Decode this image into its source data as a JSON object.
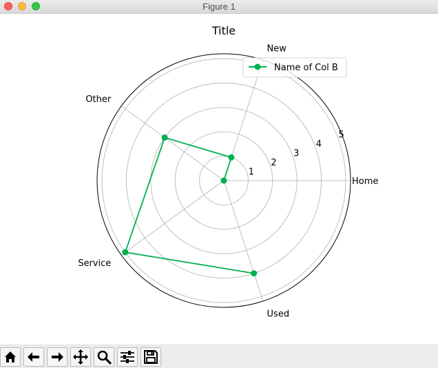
{
  "window": {
    "title": "Figure 1",
    "controls": {
      "close_color": "#fc605c",
      "minimize_color": "#fdbc40",
      "maximize_color": "#34c84a"
    }
  },
  "toolbar": {
    "buttons": [
      {
        "name": "home-button",
        "icon": "home-icon"
      },
      {
        "name": "back-button",
        "icon": "arrow-left-icon"
      },
      {
        "name": "forward-button",
        "icon": "arrow-right-icon"
      },
      {
        "name": "pan-button",
        "icon": "move-arrows-icon"
      },
      {
        "name": "zoom-button",
        "icon": "magnifier-icon"
      },
      {
        "name": "configure-subplots-button",
        "icon": "sliders-icon"
      },
      {
        "name": "save-button",
        "icon": "floppy-disk-icon"
      }
    ]
  },
  "chart_data": {
    "type": "radar",
    "title": "Title",
    "categories": [
      "Home",
      "New",
      "Other",
      "Service",
      "Used"
    ],
    "series": [
      {
        "name": "Name of Col B",
        "color": "#00b04f",
        "values": [
          0,
          1,
          3,
          5,
          4
        ]
      }
    ],
    "radial_ticks": [
      "1",
      "2",
      "3",
      "4",
      "5"
    ],
    "rlim": [
      0,
      5.2
    ],
    "grid": true,
    "legend_position": "upper-right"
  }
}
